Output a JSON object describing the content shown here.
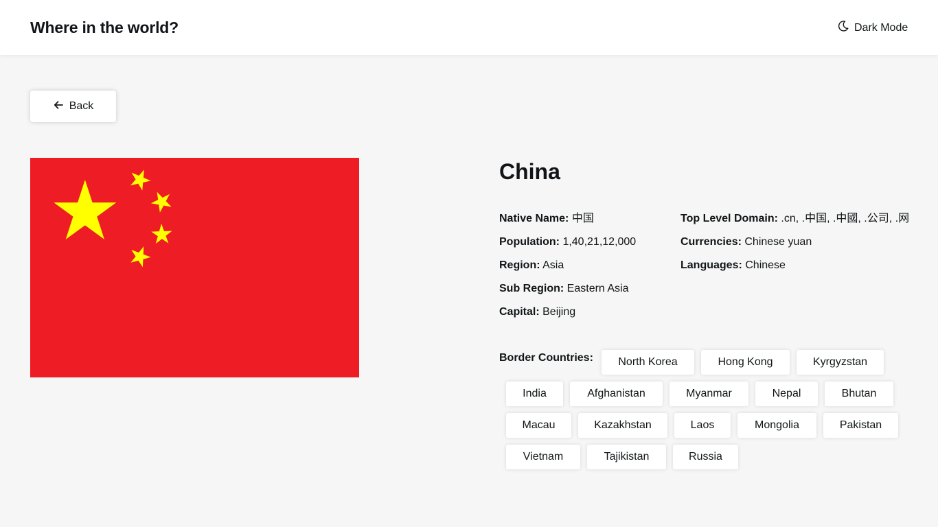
{
  "header": {
    "title": "Where in the world?",
    "theme_toggle_label": "Dark Mode",
    "theme_toggle_icon": "moon-icon"
  },
  "back": {
    "label": "Back",
    "icon": "arrow-left-icon"
  },
  "country": {
    "name": "China",
    "flag_colors": {
      "field": "#EE1C25",
      "stars": "#FFFF00"
    },
    "details_left": [
      {
        "label": "Native Name:",
        "value": "中国"
      },
      {
        "label": "Population:",
        "value": "1,40,21,12,000"
      },
      {
        "label": "Region:",
        "value": "Asia"
      },
      {
        "label": "Sub Region:",
        "value": "Eastern Asia"
      },
      {
        "label": "Capital:",
        "value": "Beijing"
      }
    ],
    "details_right": [
      {
        "label": "Top Level Domain:",
        "value": ".cn, .中国, .中國, .公司, .网络"
      },
      {
        "label": "Currencies:",
        "value": "Chinese yuan"
      },
      {
        "label": "Languages:",
        "value": "Chinese"
      }
    ],
    "border_label": "Border Countries:",
    "border_countries": [
      "North Korea",
      "Hong Kong",
      "Kyrgyzstan",
      "India",
      "Afghanistan",
      "Myanmar",
      "Nepal",
      "Bhutan",
      "Macau",
      "Kazakhstan",
      "Laos",
      "Mongolia",
      "Pakistan",
      "Vietnam",
      "Tajikistan",
      "Russia"
    ]
  },
  "colors": {
    "background": "#f6f6f6",
    "surface": "#ffffff",
    "text": "#111517"
  }
}
